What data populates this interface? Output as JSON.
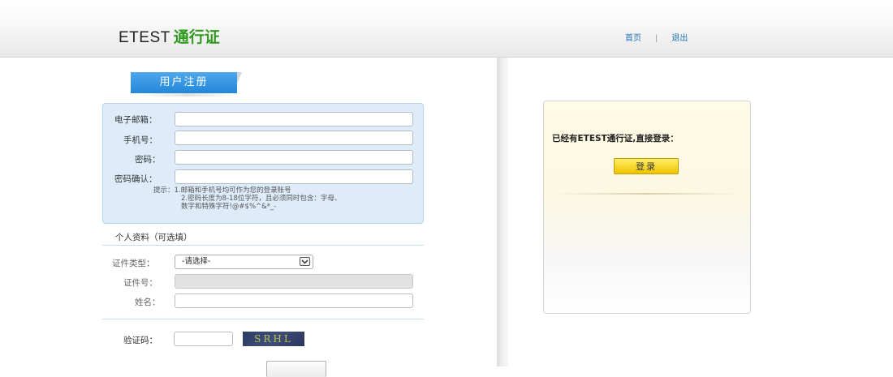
{
  "header": {
    "logo_en": "ETEST",
    "logo_cn": "通行证",
    "nav": {
      "home": "首页",
      "separator": "|",
      "logout": "退出"
    }
  },
  "register": {
    "tab_label": "用户注册",
    "fields": {
      "email_label": "电子邮箱：",
      "phone_label": "手机号：",
      "password_label": "密码：",
      "confirm_label": "密码确认："
    },
    "tips": [
      "提示：1.邮箱和手机号均可作为您的登录账号",
      "2.密码长度为8-18位字符，且必须同时包含：字母、",
      "数字和特殊字符!@#$%^&*_-"
    ]
  },
  "profile": {
    "section_title": "个人资料（可选填）",
    "id_type_label": "证件类型：",
    "id_type_value": "-请选择-",
    "id_number_label": "证件号：",
    "name_label": "姓名："
  },
  "captcha": {
    "label": "验证码：",
    "image_text": "SRHL"
  },
  "login_panel": {
    "message": "已经有ETEST通行证,直接登录：",
    "button_label": "登录"
  },
  "colors": {
    "brand_green": "#2f9a1e",
    "link_blue": "#1f6fb5",
    "tab_blue": "#2287d8",
    "box_blue": "#deecfa",
    "login_yellow": "#f0c400"
  }
}
